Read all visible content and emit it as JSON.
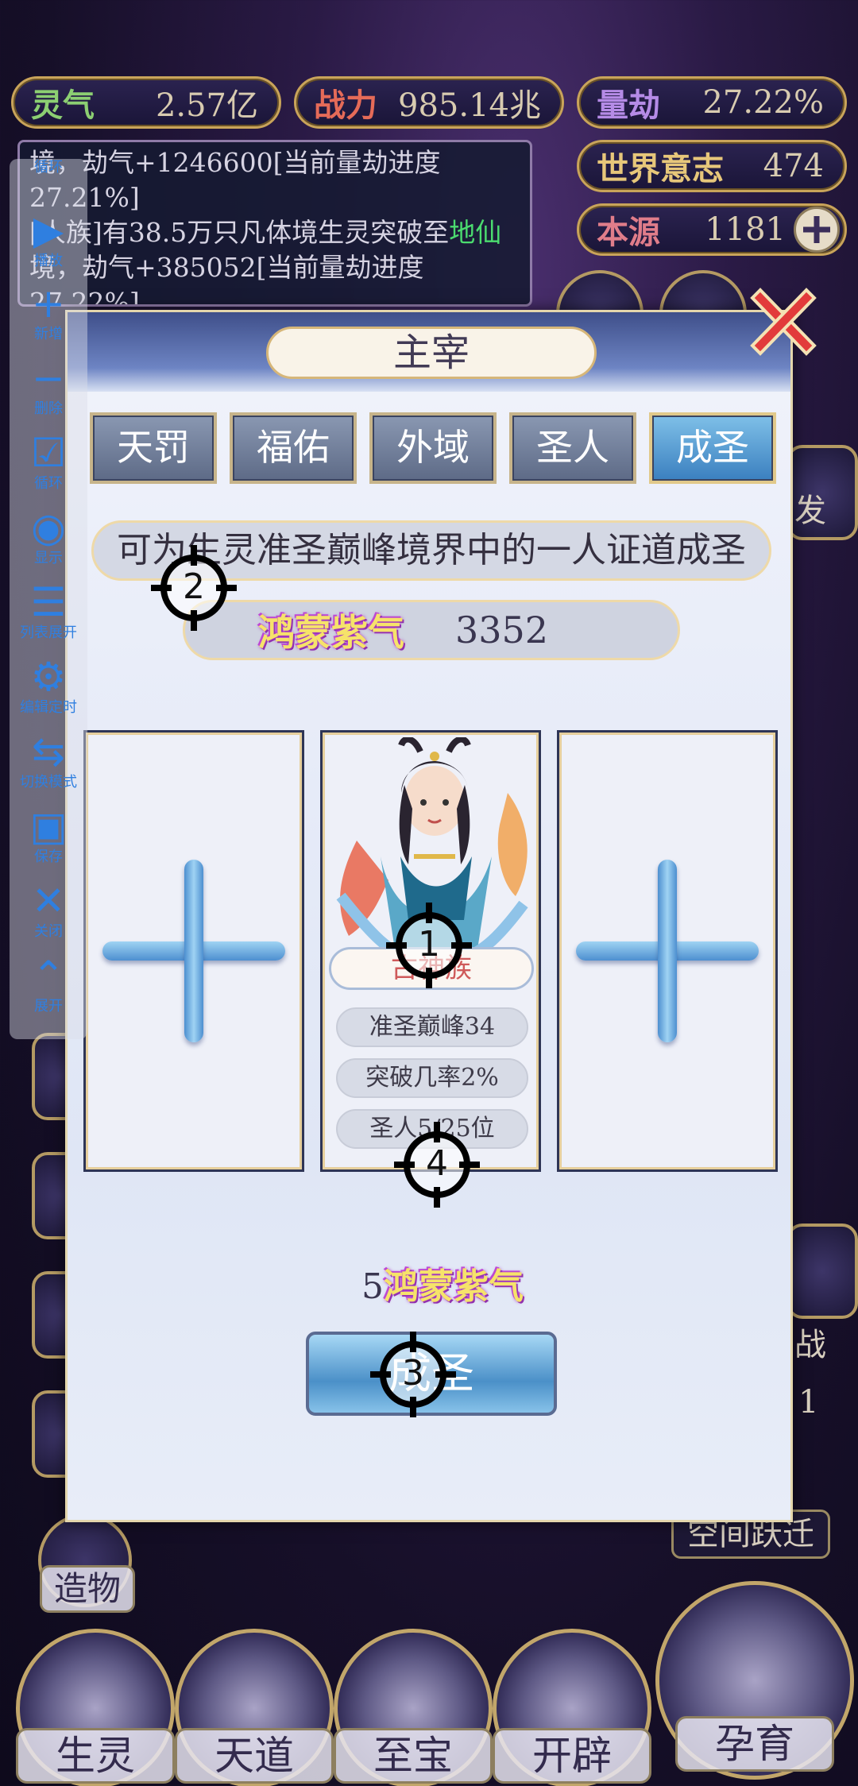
{
  "stats": {
    "lingqi": {
      "label": "灵气",
      "value": "2.57亿"
    },
    "zhanli": {
      "label": "战力",
      "value": "985.14兆"
    },
    "liangjie": {
      "label": "量劫",
      "value": "27.22%"
    },
    "shijie": {
      "label": "世界意志",
      "value": "474"
    },
    "benyuan": {
      "label": "本源",
      "value": "1181"
    }
  },
  "log": {
    "line1": "境，劫气+1246600[当前量劫进度",
    "line2": "27.21%]",
    "line3a": "[人族]有38.5万只凡体境生灵突破至",
    "line3b": "地仙",
    "line4": "境，劫气+385052[当前量劫进度",
    "line5": "27.22%]"
  },
  "right_side": {
    "fa": "发",
    "zhan": "战",
    "num": "1",
    "kongjian": "空间跃迁"
  },
  "left_side": {
    "zaowu": "造物"
  },
  "bottom_nav": [
    "生灵",
    "天道",
    "至宝",
    "开辟",
    "孕育"
  ],
  "toolbar": [
    {
      "icon": "loop-icon",
      "glyph": "⟳",
      "label": "循环"
    },
    {
      "icon": "play-icon",
      "glyph": "▶",
      "label": "播放"
    },
    {
      "icon": "add-icon",
      "glyph": "+",
      "label": "新增"
    },
    {
      "icon": "minus-icon",
      "glyph": "−",
      "label": "删除"
    },
    {
      "icon": "checkbox-icon",
      "glyph": "☑",
      "label": "循环"
    },
    {
      "icon": "eye-icon",
      "glyph": "◉",
      "label": "显示"
    },
    {
      "icon": "list-expand-icon",
      "glyph": "☰",
      "label": "列表展开"
    },
    {
      "icon": "gear-icon",
      "glyph": "⚙",
      "label": "编辑定时"
    },
    {
      "icon": "switch-icon",
      "glyph": "⇆",
      "label": "切换模式"
    },
    {
      "icon": "save-icon",
      "glyph": "▣",
      "label": "保存"
    },
    {
      "icon": "close-icon",
      "glyph": "✕",
      "label": "关闭"
    },
    {
      "icon": "expand-icon",
      "glyph": "⌃",
      "label": "展开"
    }
  ],
  "modal": {
    "title": "主宰",
    "tabs": [
      {
        "label": "天罚",
        "active": false
      },
      {
        "label": "福佑",
        "active": false
      },
      {
        "label": "外域",
        "active": false
      },
      {
        "label": "圣人",
        "active": false
      },
      {
        "label": "成圣",
        "active": true
      }
    ],
    "description": "可为生灵准圣巅峰境界中的一人证道成圣",
    "resource_label": "鸿蒙紫气",
    "resource_value": "3352",
    "center_card": {
      "race": "古神族",
      "realm": "准圣巅峰34",
      "chance": "突破几率2%",
      "rank": "圣人5/25位"
    },
    "cost_amount": "5",
    "cost_label": "鸿蒙紫气",
    "action_button": "成圣"
  },
  "markers": [
    "1",
    "2",
    "3",
    "4"
  ],
  "colors": {
    "accent_gold": "#c9a45a",
    "tab_active": "#3a7fbf",
    "toolbar_blue": "#2f7fe0",
    "race_red": "#cf5a5a"
  }
}
